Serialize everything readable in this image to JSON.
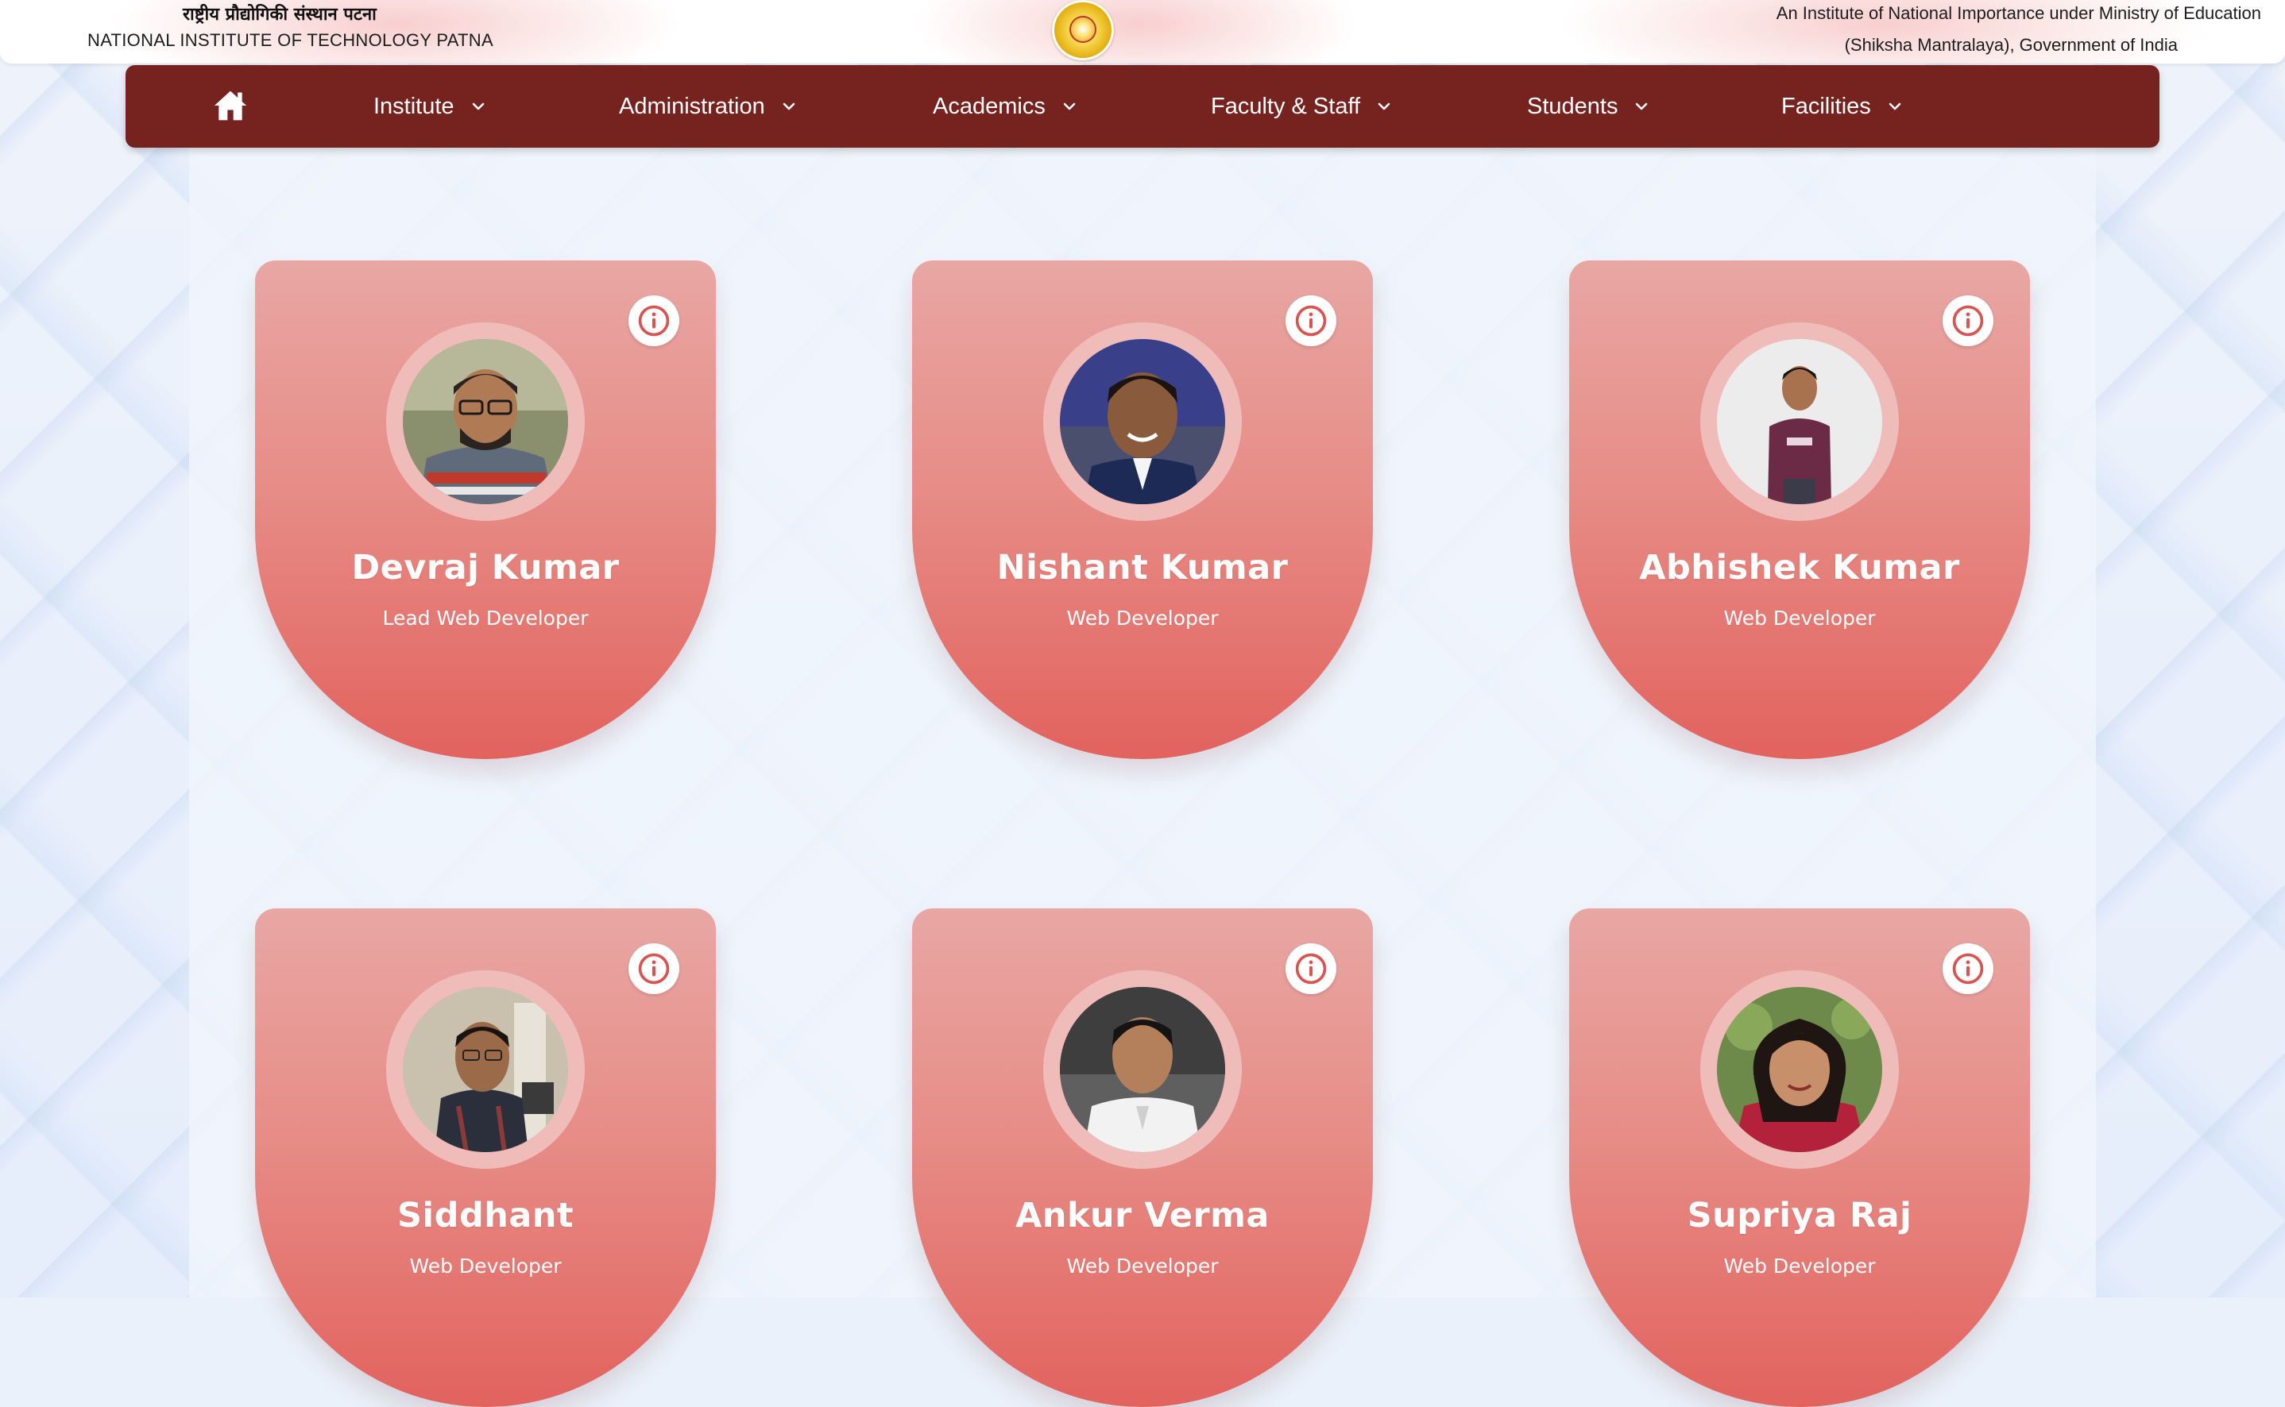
{
  "header": {
    "hindi_name": "राष्ट्रीय प्रौद्योगिकी संस्थान पटना",
    "english_name": "NATIONAL INSTITUTE OF TECHNOLOGY PATNA",
    "tagline_line1": "An Institute of National Importance under Ministry of Education",
    "tagline_line2": "(Shiksha Mantralaya), Government of India",
    "logo_icon": "nit-patna-logo"
  },
  "nav": {
    "home_icon": "home-icon",
    "items": [
      {
        "label": "Institute"
      },
      {
        "label": "Administration"
      },
      {
        "label": "Academics"
      },
      {
        "label": "Faculty & Staff"
      },
      {
        "label": "Students"
      },
      {
        "label": "Facilities"
      }
    ],
    "background": "#76221e"
  },
  "cards": [
    {
      "name": "Devraj Kumar",
      "role": "Lead Web Developer",
      "photo_icon": "person-photo"
    },
    {
      "name": "Nishant Kumar",
      "role": "Web Developer",
      "photo_icon": "person-photo"
    },
    {
      "name": "Abhishek Kumar",
      "role": "Web Developer",
      "photo_icon": "person-photo"
    },
    {
      "name": "Siddhant",
      "role": "Web Developer",
      "photo_icon": "person-photo"
    },
    {
      "name": "Ankur Verma",
      "role": "Web Developer",
      "photo_icon": "person-photo"
    },
    {
      "name": "Supriya Raj",
      "role": "Web Developer",
      "photo_icon": "person-photo"
    }
  ],
  "colors": {
    "card_top": "#e8a7a4",
    "card_bottom": "#e2625e",
    "info_icon": "#d9534f"
  }
}
